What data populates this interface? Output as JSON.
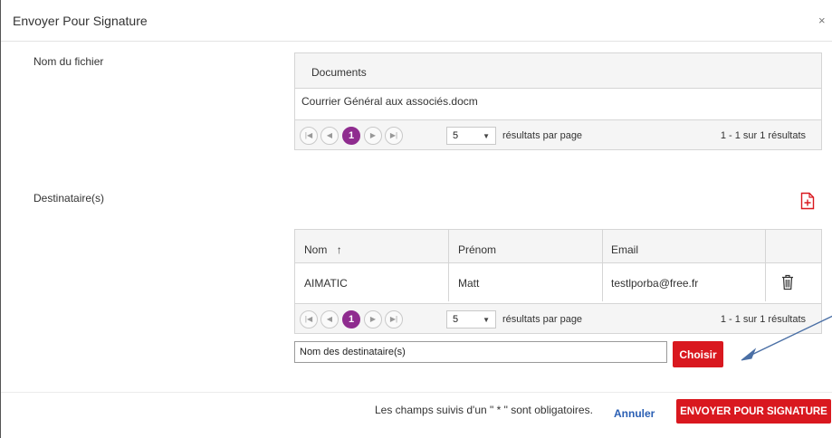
{
  "dialog": {
    "title": "Envoyer Pour Signature",
    "close_glyph": "×"
  },
  "file_section": {
    "label": "Nom du fichier",
    "grid": {
      "header": "Documents",
      "rows": [
        "Courrier Général aux associés.docm"
      ],
      "pager": {
        "current_page": "1",
        "page_size": "5",
        "per_page_label": "résultats par page",
        "summary": "1 - 1 sur 1 résultats"
      }
    }
  },
  "recipients_section": {
    "label": "Destinataire(s)",
    "add_icon": "document-plus-icon",
    "grid": {
      "columns": [
        "Nom",
        "Prénom",
        "Email"
      ],
      "sort_glyph": "↑",
      "rows": [
        {
          "nom": "AIMATIC",
          "prenom": "Matt",
          "email": "testlporba@free.fr"
        }
      ],
      "delete_icon": "trash-icon",
      "pager": {
        "current_page": "1",
        "page_size": "5",
        "per_page_label": "résultats par page",
        "summary": "1 - 1 sur 1 résultats"
      }
    },
    "name_input": {
      "value": "Nom des destinataire(s)"
    },
    "choose_button": "Choisir"
  },
  "footer": {
    "required_note": "Les champs suivis d'un \" * \" sont obligatoires.",
    "cancel_label": "Annuler",
    "send_label": "ENVOYER POUR SIGNATURE"
  },
  "colors": {
    "accent_red": "#d9181f",
    "pager_active": "#8f2c8f",
    "link_blue": "#2a5fb4",
    "annotation_arrow": "#4a6fa5"
  },
  "pager_glyphs": {
    "first": "|◀",
    "prev": "◀",
    "next": "▶",
    "last": "▶|",
    "dropdown": "▼"
  }
}
